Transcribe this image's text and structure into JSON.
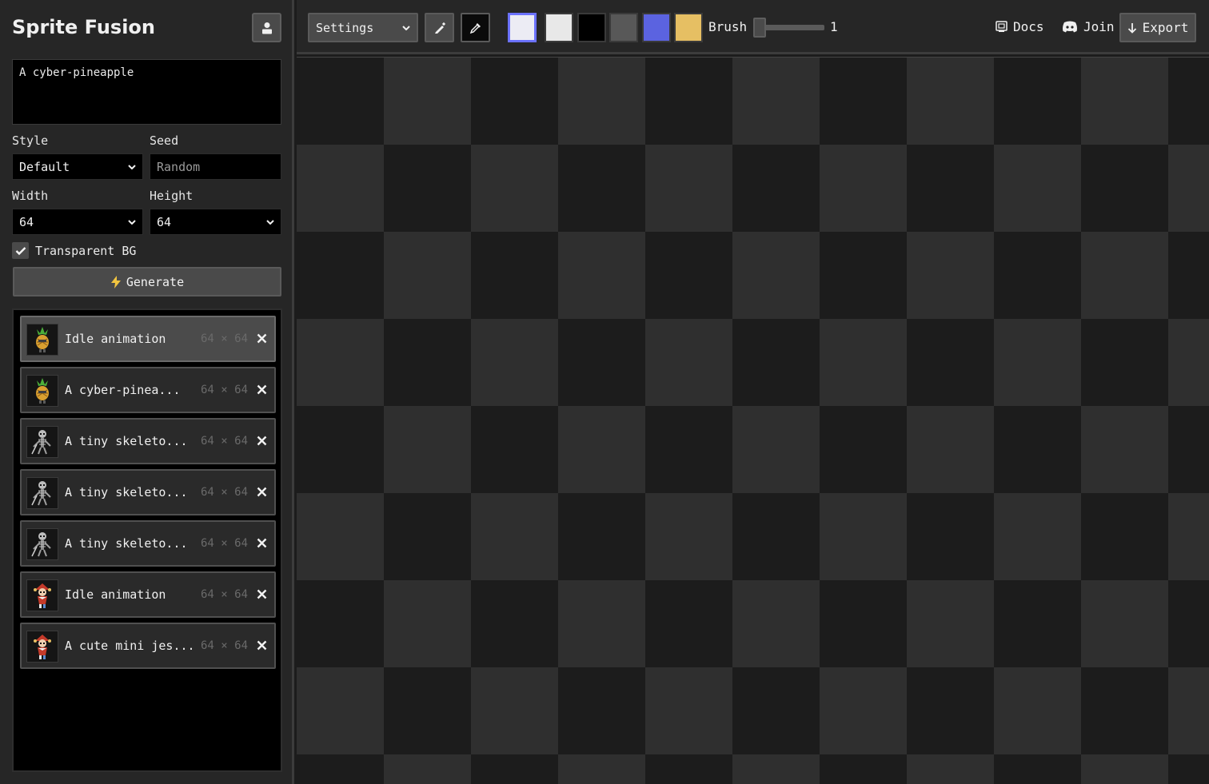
{
  "sidebar": {
    "brand": "Sprite Fusion",
    "prompt": "A cyber-pineapple",
    "style": {
      "label": "Style",
      "value": "Default"
    },
    "seed": {
      "label": "Seed",
      "placeholder": "Random"
    },
    "width": {
      "label": "Width",
      "value": "64"
    },
    "height": {
      "label": "Height",
      "value": "64"
    },
    "transparent_bg": {
      "label": "Transparent BG",
      "checked": true
    },
    "generate_label": "Generate",
    "history": [
      {
        "name": "Idle animation",
        "size": "64 × 64",
        "active": true,
        "thumb": "pineapple-sprite"
      },
      {
        "name": "A cyber-pinea...",
        "size": "64 × 64",
        "active": false,
        "thumb": "pineapple-sprite"
      },
      {
        "name": "A tiny skeleto...",
        "size": "64 × 64",
        "active": false,
        "thumb": "skeleton-sprite"
      },
      {
        "name": "A tiny skeleto...",
        "size": "64 × 64",
        "active": false,
        "thumb": "skeleton-sprite"
      },
      {
        "name": "A tiny skeleto...",
        "size": "64 × 64",
        "active": false,
        "thumb": "skeleton-sprite"
      },
      {
        "name": "Idle animation",
        "size": "64 × 64",
        "active": false,
        "thumb": "jester-sprite"
      },
      {
        "name": "A cute mini jes...",
        "size": "64 × 64",
        "active": false,
        "thumb": "jester-sprite"
      }
    ]
  },
  "toolbar": {
    "settings_label": "Settings",
    "palette": [
      "#ececf4",
      "#e8e8e8",
      "#000000",
      "#585858",
      "#5b63e0",
      "#e6bf63"
    ],
    "selected_swatch": 0,
    "brush_label": "Brush",
    "brush_value": "1",
    "docs_label": "Docs",
    "join_label": "Join",
    "export_label": "Export"
  },
  "colors": {
    "accent": "#6b72ff",
    "panel": "#262626",
    "button": "#4a4a4a"
  }
}
